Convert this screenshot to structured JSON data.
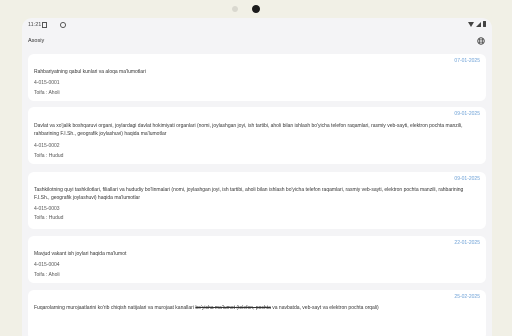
{
  "status": {
    "time": "11:21"
  },
  "appbar": {
    "title": "Asosiy"
  },
  "cards": [
    {
      "date": "07-01-2025",
      "desc": "Rahbariyatning qabul kunlari va aloqa ma'lumotlari",
      "code": "4-015-0001",
      "type": "Toifa : Aholi"
    },
    {
      "date": "09-01-2025",
      "desc": "Davlat va xo'jalik boshqaruvi organi, joylardagi davlat hokimiyati organlari (nomi, joylashgan joyi, ish tartibi, aholi bilan ishlash bo'yicha telefon raqamlari, rasmiy veb-sayti, elektron pochta manzili, rahbarining F.I.Sh., geografik joylashuvi) haqida ma'lumotlar",
      "code": "4-015-0002",
      "type": "Toifa : Hudud"
    },
    {
      "date": "09-01-2025",
      "desc": "Tashkilotning quyi tashkilotlari, filiallari va hududiy bo'linmalari (nomi, joylashgan joyi, ish tartibi, aholi bilan ishlash bo'yicha telefon raqamlari, rasmiy veb-sayti, elektron pochta manzili, rahbarining F.I.Sh., geografik joylashuvi) haqida ma'lumotlar",
      "code": "4-015-0003",
      "type": "Toifa : Hudud"
    },
    {
      "date": "22-01-2025",
      "desc": "Mavjud vakant ish joylari haqida ma'lumot",
      "code": "4-015-0004",
      "type": "Toifa : Aholi"
    },
    {
      "date": "25-02-2025",
      "desc_a": "Fuqarolarning murojaatlarini ko'rib chiqish natijalari va murojaat kanallari ",
      "desc_b": "bo'yicha ma'lumot (telefon, pochta",
      "desc_c": " va navbatda, veb-sayt va elektron pochta orqali)"
    }
  ]
}
